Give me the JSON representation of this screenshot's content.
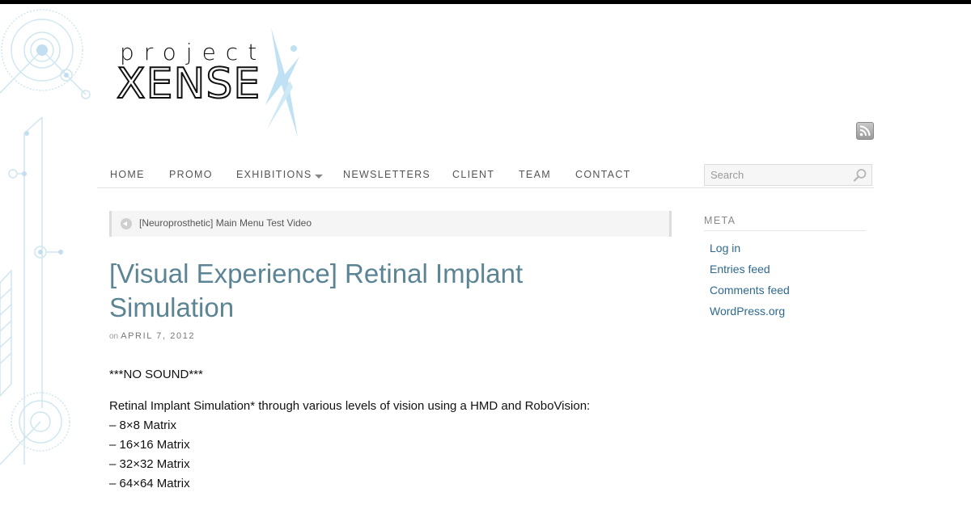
{
  "logo": {
    "small": "project",
    "big": "XENSE"
  },
  "nav": {
    "items": [
      "HOME",
      "PROMO",
      "EXHIBITIONS",
      "NEWSLETTERS",
      "CLIENT",
      "TEAM",
      "CONTACT"
    ]
  },
  "search": {
    "placeholder": "Search"
  },
  "prev_post": {
    "label": "[Neuroprosthetic] Main Menu Test Video"
  },
  "post": {
    "title": "[Visual Experience] Retinal Implant Simulation",
    "meta_prefix": "on",
    "date": "APRIL 7, 2012",
    "body": [
      "***NO SOUND***",
      "Retinal Implant Simulation* through various levels of vision using a HMD and RoboVision:",
      "– 8×8 Matrix",
      "– 16×16 Matrix",
      "– 32×32 Matrix",
      "– 64×64 Matrix"
    ]
  },
  "sidebar": {
    "title": "META",
    "links": [
      "Log in",
      "Entries feed",
      "Comments feed",
      "WordPress.org"
    ]
  },
  "colors": {
    "accent": "#5b8494",
    "link": "#2e6a8f",
    "decor": "#c6e3f0",
    "top_bar": "#000000"
  },
  "icons": [
    "rss-icon",
    "search-icon",
    "arrow-left-icon",
    "nav-caret-icon"
  ]
}
